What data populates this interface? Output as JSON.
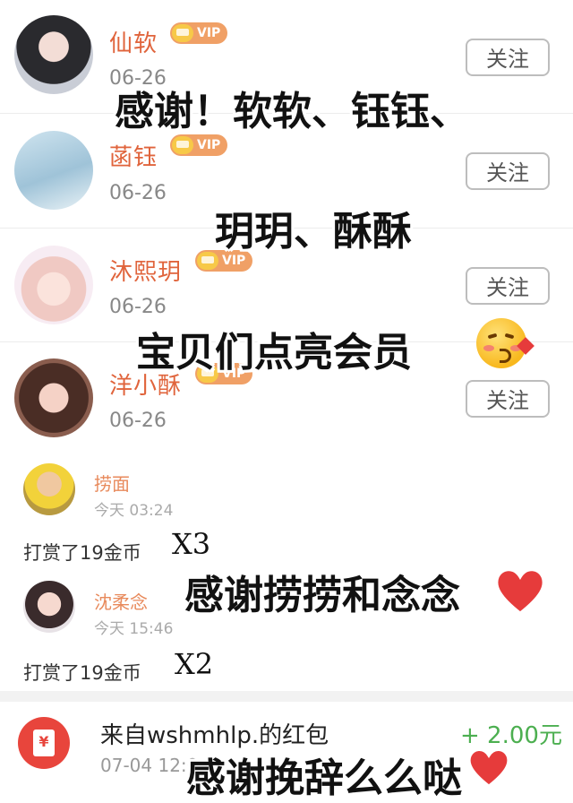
{
  "follow_list": [
    {
      "name": "仙软",
      "vip": "VIP",
      "date": "06-26",
      "follow": "关注"
    },
    {
      "name": "菡钰",
      "vip": "VIP",
      "date": "06-26",
      "follow": "关注"
    },
    {
      "name": "沐熙玥",
      "vip": "VIP",
      "date": "06-26",
      "follow": "关注"
    },
    {
      "name": "洋小酥",
      "vip": "VIP",
      "date": "06-26",
      "follow": "关注"
    }
  ],
  "overlays": {
    "line1": "感谢！软软、钰钰、",
    "line2": "玥玥、酥酥",
    "line3": "宝贝们点亮会员",
    "line4": "感谢捞捞和念念",
    "line5": "感谢挽辞么么哒"
  },
  "tips": [
    {
      "name": "捞面",
      "time": "今天 03:24",
      "action": "打赏了19金币",
      "multiplier": "X3"
    },
    {
      "name": "沈柔念",
      "time": "今天 15:46",
      "action": "打赏了19金币",
      "multiplier": "X2"
    }
  ],
  "red_packet": {
    "title": "来自wshmhlp.的红包",
    "amount": "+ 2.00元",
    "time": "07-04 12:0",
    "icon": "red-envelope-icon",
    "icon_glyph": "¥"
  },
  "colors": {
    "username": "#e0643c",
    "vip": "#f0a066",
    "amount": "#4caf50",
    "heart": "#e63b3b"
  }
}
